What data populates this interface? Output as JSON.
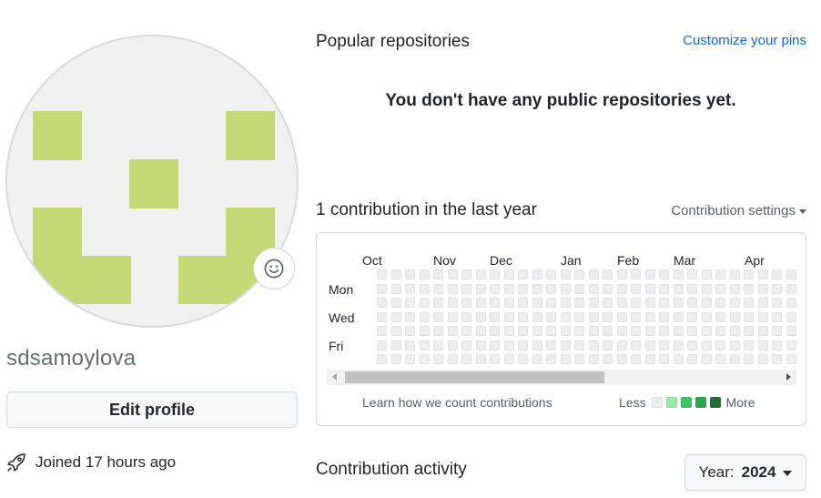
{
  "profile": {
    "username": "sdsamoylova",
    "edit_label": "Edit profile",
    "joined_text": "Joined 17 hours ago",
    "avatar_color": "#c2d975",
    "status_icon": "smiley-icon"
  },
  "repos": {
    "title": "Popular repositories",
    "customize_label": "Customize your pins",
    "empty_message": "You don't have any public repositories yet."
  },
  "contributions": {
    "title": "1 contribution in the last year",
    "settings_label": "Contribution settings",
    "months": [
      "Oct",
      "Nov",
      "Dec",
      "Jan",
      "Feb",
      "Mar",
      "Apr"
    ],
    "day_labels": [
      "Mon",
      "Wed",
      "Fri"
    ],
    "learn_label": "Learn how we count contributions",
    "legend_less": "Less",
    "legend_more": "More",
    "legend_colors": [
      "#ebedf0",
      "#9be9a8",
      "#40c463",
      "#30a14e",
      "#216e39"
    ],
    "empty_cell_color": "#ebedf0",
    "weeks_visible": 30
  },
  "activity": {
    "title": "Contribution activity",
    "year_prefix": "Year:",
    "year_value": "2024"
  }
}
